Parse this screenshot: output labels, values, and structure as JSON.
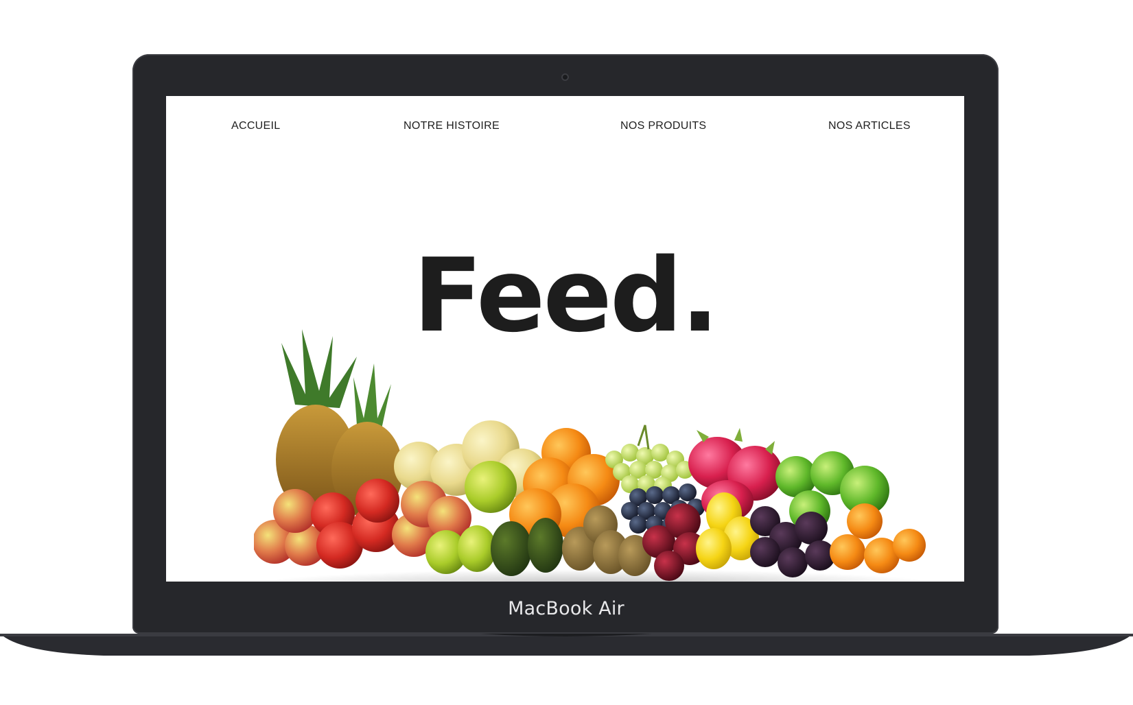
{
  "nav": {
    "items": [
      {
        "label": "ACCUEIL"
      },
      {
        "label": "NOTRE HISTOIRE"
      },
      {
        "label": "NOS PRODUITS"
      },
      {
        "label": "NOS ARTICLES"
      }
    ]
  },
  "hero": {
    "title": "Feed."
  },
  "device": {
    "label": "MacBook Air"
  },
  "colors": {
    "device_body": "#26272b",
    "screen_bg": "#ffffff",
    "text": "#1d1d1d"
  }
}
